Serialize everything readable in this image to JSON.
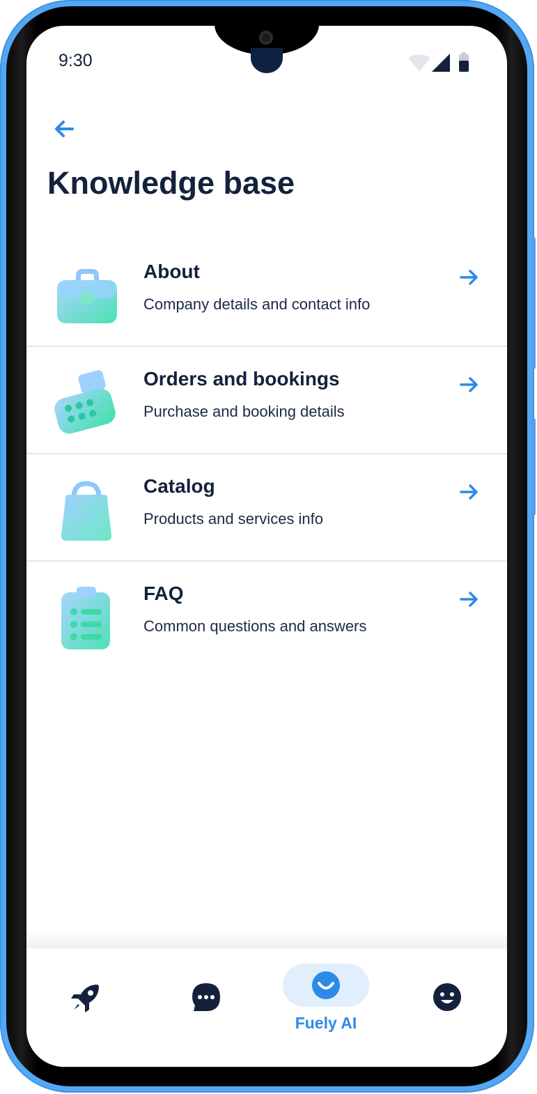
{
  "status_bar": {
    "time": "9:30"
  },
  "page": {
    "title": "Knowledge base"
  },
  "items": [
    {
      "title": "About",
      "subtitle": "Company details and contact info",
      "icon": "briefcase-icon"
    },
    {
      "title": "Orders and bookings",
      "subtitle": "Purchase and booking details",
      "icon": "cash-register-icon"
    },
    {
      "title": "Catalog",
      "subtitle": "Products and services info",
      "icon": "shopping-bag-icon"
    },
    {
      "title": "FAQ",
      "subtitle": "Common questions and answers",
      "icon": "clipboard-list-icon"
    }
  ],
  "bottom_nav": {
    "items": [
      {
        "icon": "rocket-icon",
        "label": ""
      },
      {
        "icon": "chat-bubble-icon",
        "label": ""
      },
      {
        "icon": "smile-icon",
        "label": "Fuely AI",
        "active": true
      },
      {
        "icon": "emoji-face-icon",
        "label": ""
      }
    ]
  },
  "colors": {
    "frame": "#55a7f4",
    "accent": "#2d8ae6",
    "text": "#14213d",
    "active_bg": "#e1eefc"
  }
}
